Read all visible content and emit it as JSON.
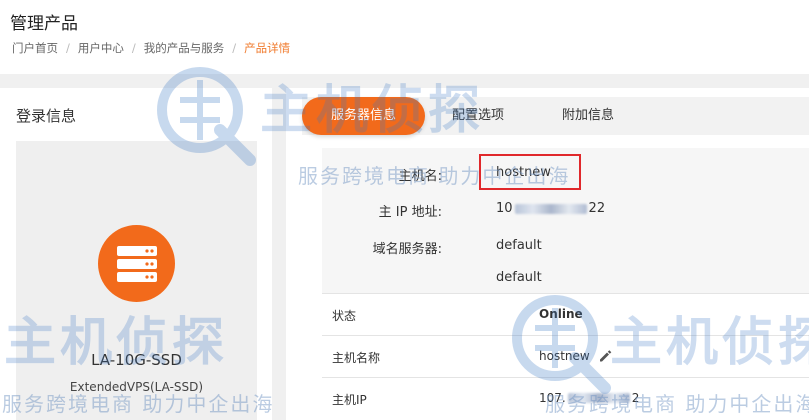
{
  "header": {
    "title": "管理产品",
    "breadcrumb": [
      {
        "label": "门户首页"
      },
      {
        "label": "用户中心"
      },
      {
        "label": "我的产品与服务"
      },
      {
        "label": "产品详情"
      }
    ]
  },
  "login_panel": {
    "title": "登录信息",
    "product_name": "LA-10G-SSD",
    "product_plan": "ExtendedVPS(LA-SSD)",
    "product_icon": "server-icon"
  },
  "tabs": [
    {
      "label": "服务器信息",
      "active": true
    },
    {
      "label": "配置选项",
      "active": false
    },
    {
      "label": "附加信息",
      "active": false
    }
  ],
  "server_info": {
    "hostname_label": "主机名:",
    "hostname_value": "hostnew",
    "ip_label": "主 IP 地址:",
    "ip_value_prefix": "10",
    "ip_value_suffix": "22",
    "ns_label": "域名服务器:",
    "ns1": "default",
    "ns2": "default"
  },
  "table": {
    "status_label": "状态",
    "status_value": "Online",
    "hostname_label": "主机名称",
    "hostname_value": "hostnew",
    "ip_label": "主机IP",
    "ip_value_prefix": "107.",
    "ip_value_suffix": "2"
  },
  "watermark": {
    "brand": "主机侦探",
    "slogan": "服务跨境电商 助力中企出海"
  },
  "colors": {
    "accent": "#f26a1b",
    "breadcrumb_active": "#f07b2e",
    "online": "#2f9e2f",
    "highlight_border": "#e0282b"
  }
}
